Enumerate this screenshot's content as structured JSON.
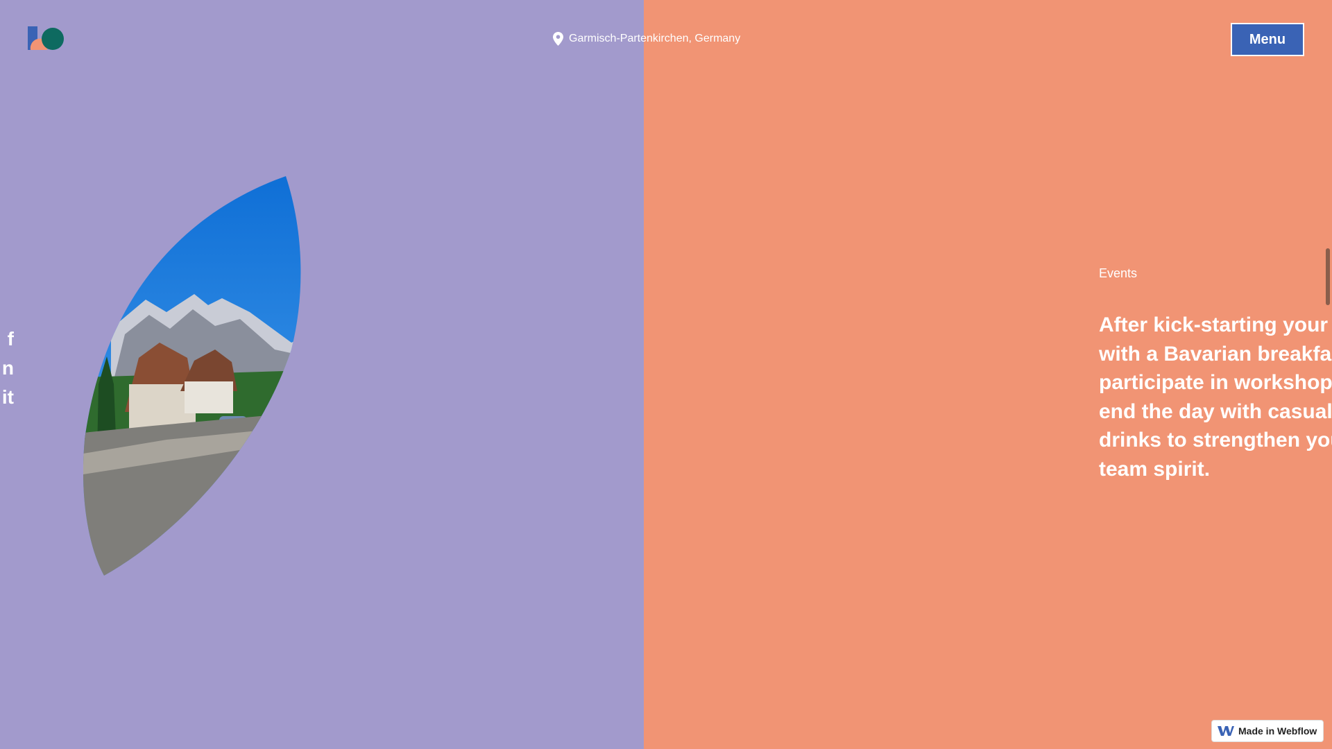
{
  "colors": {
    "left_panel": "#a29acc",
    "right_panel": "#f19474",
    "menu_button": "#3a63b5",
    "text": "#ffffff"
  },
  "header": {
    "logo_icon": "brand-logo",
    "location_icon": "map-pin-icon",
    "location": "Garmisch-Partenkirchen, Germany",
    "menu_label": "Menu"
  },
  "hero": {
    "cut_off_lines": [
      "f",
      "n",
      "it"
    ],
    "image": "alpine-village-photo"
  },
  "section": {
    "eyebrow": "Events",
    "paragraph": "After kick-starting your day with a Bavarian breakfast, participate in workshops and end the day with casual work drinks to strengthen your team spirit."
  },
  "badge": {
    "icon": "webflow-icon",
    "label": "Made in Webflow"
  }
}
